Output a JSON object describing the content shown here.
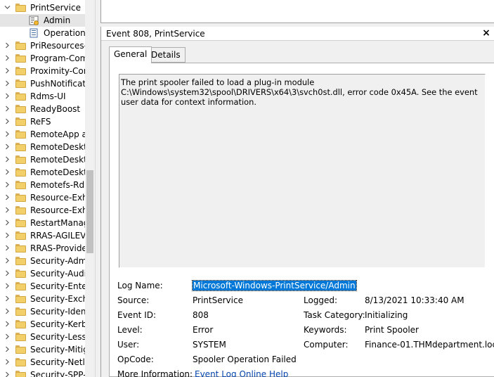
{
  "tree": {
    "parent": {
      "label": "PrintService",
      "chevron": "v"
    },
    "children": [
      {
        "label": "Admin",
        "icon": "admin-log-icon",
        "selected": true
      },
      {
        "label": "Operational",
        "icon": "operational-log-icon",
        "selected": false
      }
    ],
    "items": [
      "PriResources-D",
      "Program-Com",
      "Proximity-Con",
      "PushNotificati",
      "Rdms-UI",
      "ReadyBoost",
      "ReFS",
      "RemoteApp an",
      "RemoteDeskto",
      "RemoteDeskto",
      "RemoteDeskto",
      "Remotefs-Rdb",
      "Resource-Exha",
      "Resource-Exha",
      "RestartManage",
      "RRAS-AGILEVP",
      "RRAS-Provider",
      "Security-Admi",
      "Security-Audit",
      "Security-Enterp",
      "Security-Excha",
      "Security-Identi",
      "Security-Kerbe",
      "Security-LessP",
      "Security-Mitig",
      "Security-Netlo",
      "Security-SPP-U"
    ],
    "chevron_glyph": ">"
  },
  "event": {
    "title": "Event 808, PrintService",
    "close_glyph": "×",
    "tabs": {
      "general": "General",
      "details": "Details"
    },
    "description": "The print spooler failed to load a plug-in module C:\\Windows\\system32\\spool\\DRIVERS\\x64\\3\\svch0st.dll, error code 0x45A. See the event user data for context information.",
    "fields": {
      "log_name_label": "Log Name:",
      "log_name_value": "Microsoft-Windows-PrintService/Admin",
      "source_label": "Source:",
      "source_value": "PrintService",
      "logged_label": "Logged:",
      "logged_value": "8/13/2021 10:33:40 AM",
      "event_id_label": "Event ID:",
      "event_id_value": "808",
      "task_category_label": "Task Category:",
      "task_category_value": "Initializing",
      "level_label": "Level:",
      "level_value": "Error",
      "keywords_label": "Keywords:",
      "keywords_value": "Print Spooler",
      "user_label": "User:",
      "user_value": "SYSTEM",
      "computer_label": "Computer:",
      "computer_value": "Finance-01.THMdepartment.local",
      "opcode_label": "OpCode:",
      "opcode_value": "Spooler Operation Failed",
      "more_info_label": "More Information:",
      "more_info_link": "Event Log Online Help"
    }
  },
  "colors": {
    "selection": "#0078d7",
    "link": "#0645ad",
    "folder": "#f3cf6a"
  }
}
